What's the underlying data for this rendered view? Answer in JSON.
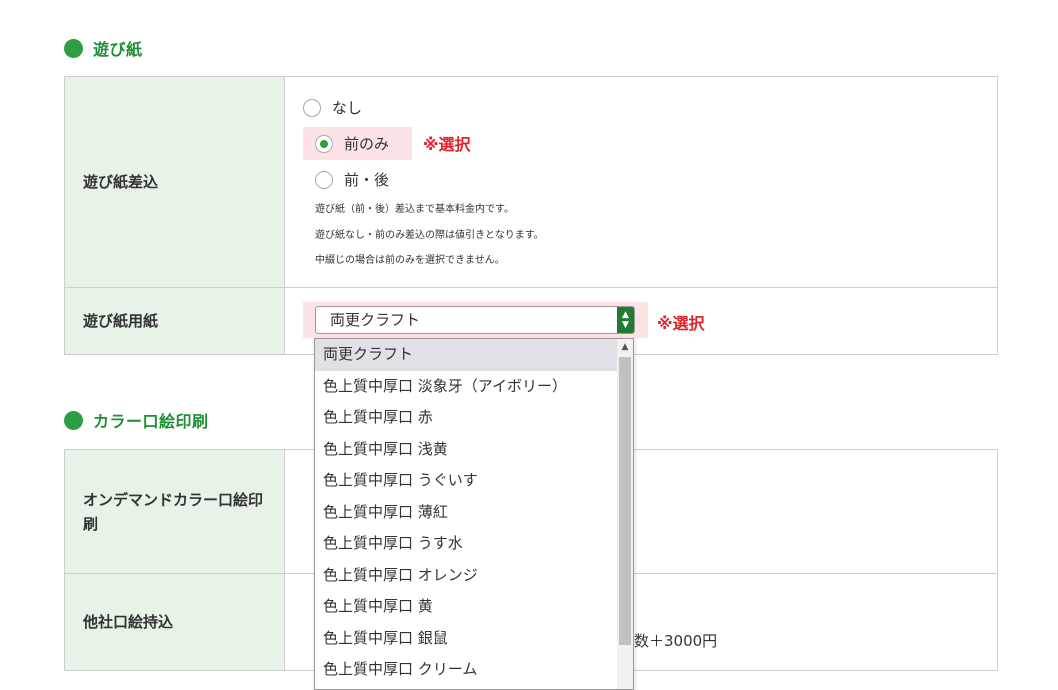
{
  "section1": {
    "title": "遊び紙"
  },
  "row_insert": {
    "label": "遊び紙差込",
    "options": [
      "なし",
      "前のみ",
      "前・後"
    ],
    "selected_index": 1,
    "select_note": "※選択",
    "notes": [
      "遊び紙（前・後）差込まで基本料金内です。",
      "遊び紙なし・前のみ差込の際は値引きとなります。",
      "中綴じの場合は前のみを選択できません。"
    ]
  },
  "row_paper": {
    "label": "遊び紙用紙",
    "value": "両更クラフト",
    "select_note": "※選択",
    "dropdown_options": [
      "両更クラフト",
      "色上質中厚口 淡象牙（アイボリー）",
      "色上質中厚口 赤",
      "色上質中厚口 浅黄",
      "色上質中厚口 うぐいす",
      "色上質中厚口 薄紅",
      "色上質中厚口 うす水",
      "色上質中厚口 オレンジ",
      "色上質中厚口 黄",
      "色上質中厚口 銀鼠",
      "色上質中厚口 クリーム"
    ]
  },
  "section2": {
    "title": "カラー口絵印刷"
  },
  "row_ondemand": {
    "label": "オンデマンドカラー口絵印刷"
  },
  "row_other": {
    "label": "他社口絵持込",
    "trailing_text": "数＋3000円"
  },
  "colors": {
    "accent_green": "#2e9e44",
    "header_bg": "#e6f3e6",
    "alert_red": "#e0242f",
    "highlight_pink": "#fce4e6"
  }
}
